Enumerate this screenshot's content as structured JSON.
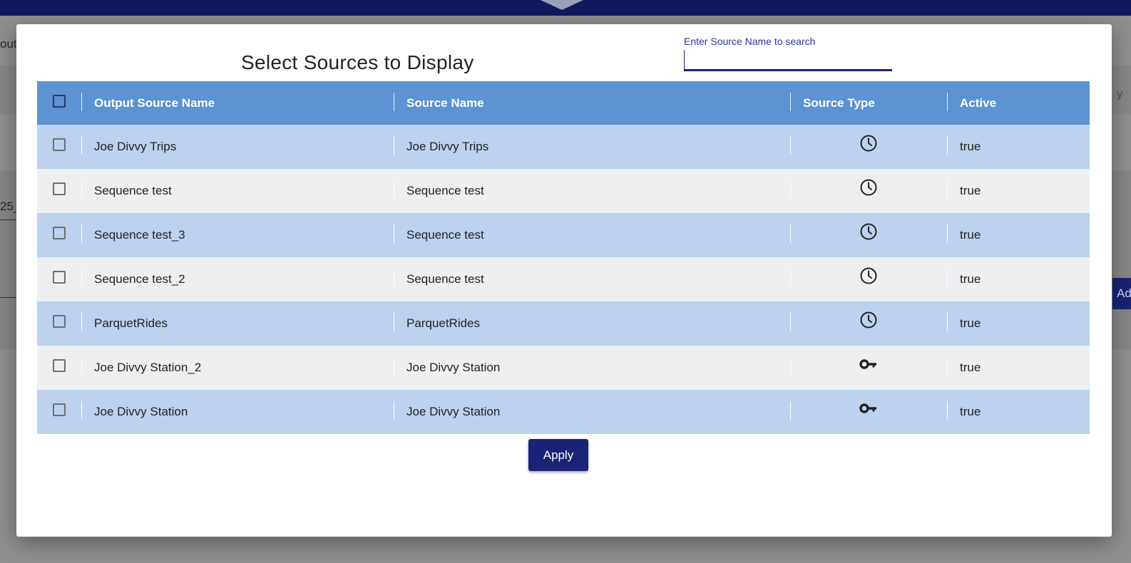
{
  "background": {
    "left_fragments": [
      "outs",
      "25_"
    ],
    "right_fragments": [
      "y",
      "Ad"
    ]
  },
  "modal": {
    "title": "Select Sources to Display",
    "search": {
      "label": "Enter Source Name to search",
      "value": ""
    },
    "columns": [
      "Output Source Name",
      "Source Name",
      "Source Type",
      "Active"
    ],
    "rows": [
      {
        "output": "Joe Divvy Trips",
        "source": "Joe Divvy Trips",
        "type_icon": "clock-icon",
        "active": "true"
      },
      {
        "output": "Sequence test",
        "source": "Sequence test",
        "type_icon": "clock-icon",
        "active": "true"
      },
      {
        "output": "Sequence test_3",
        "source": "Sequence test",
        "type_icon": "clock-icon",
        "active": "true"
      },
      {
        "output": "Sequence test_2",
        "source": "Sequence test",
        "type_icon": "clock-icon",
        "active": "true"
      },
      {
        "output": "ParquetRides",
        "source": "ParquetRides",
        "type_icon": "clock-icon",
        "active": "true"
      },
      {
        "output": "Joe Divvy Station_2",
        "source": "Joe Divvy Station",
        "type_icon": "key-icon",
        "active": "true"
      },
      {
        "output": "Joe Divvy Station",
        "source": "Joe Divvy Station",
        "type_icon": "key-icon",
        "active": "true"
      }
    ],
    "apply_label": "Apply"
  },
  "colors": {
    "header": "#5b93d3",
    "row_odd": "#bcd2ee",
    "row_even": "#eeeff1",
    "primary": "#1b2378"
  }
}
